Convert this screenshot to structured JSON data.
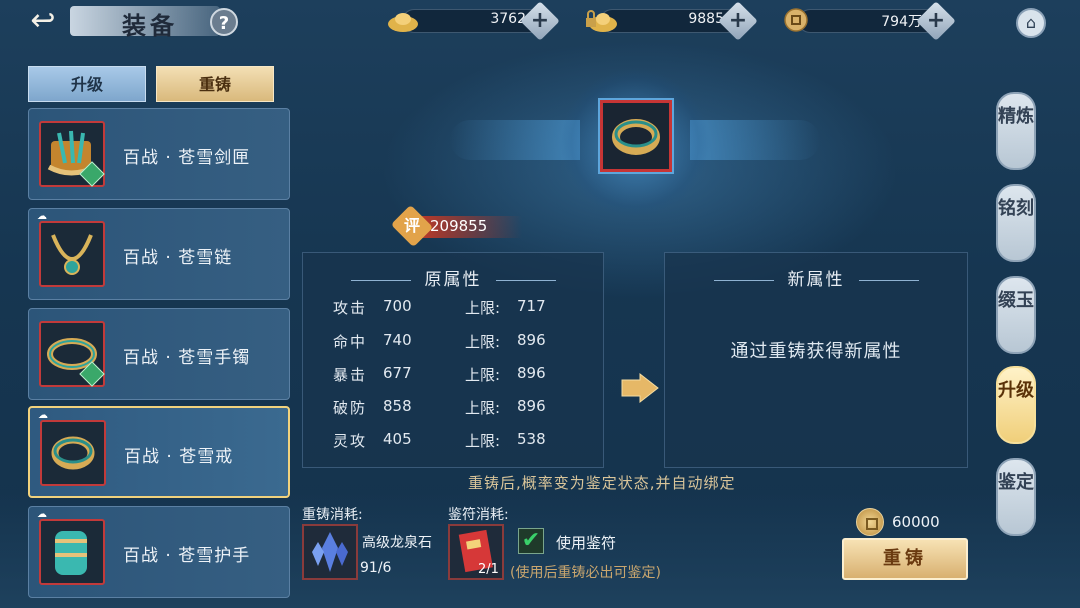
{
  "header": {
    "title": "装备",
    "back_icon": "back-arrow-icon",
    "help_label": "?"
  },
  "currencies": [
    {
      "icon": "gold-ingot-icon",
      "value": "3762",
      "plus": "+"
    },
    {
      "icon": "locked-ingot-icon",
      "value": "9885",
      "plus": "+"
    },
    {
      "icon": "copper-coin-icon",
      "value": "794万",
      "plus": "+"
    }
  ],
  "left_tabs": {
    "upgrade": "升级",
    "reforge": "重铸"
  },
  "equipment_list": [
    {
      "name": "百战 · 苍雪剑匣",
      "selected": false
    },
    {
      "name": "百战 · 苍雪链",
      "selected": false
    },
    {
      "name": "百战 · 苍雪手镯",
      "selected": false
    },
    {
      "name": "百战 · 苍雪戒",
      "selected": true
    },
    {
      "name": "百战 · 苍雪护手",
      "selected": false
    }
  ],
  "score": {
    "badge": "评",
    "value": "209855"
  },
  "old_attrs": {
    "title": "原属性",
    "limit_label": "上限:",
    "rows": [
      {
        "name": "攻击",
        "value": "700",
        "limit": "717"
      },
      {
        "name": "命中",
        "value": "740",
        "limit": "896"
      },
      {
        "name": "暴击",
        "value": "677",
        "limit": "896"
      },
      {
        "name": "破防",
        "value": "858",
        "limit": "896"
      },
      {
        "name": "灵攻",
        "value": "405",
        "limit": "538"
      }
    ]
  },
  "new_attrs": {
    "title": "新属性",
    "hint": "通过重铸获得新属性"
  },
  "notice": "重铸后,概率变为鉴定状态,并自动绑定",
  "costs": {
    "reforge_label": "重铸消耗:",
    "material_name": "高级龙泉石",
    "material_count": "91/6",
    "talisman_label": "鉴符消耗:",
    "talisman_count": "2/1",
    "use_talisman_label": "使用鉴符",
    "use_talisman_checked": true,
    "use_talisman_note": "(使用后重铸必出可鉴定)",
    "coin_cost": "60000"
  },
  "reforge_button": "重铸",
  "right_nav": [
    {
      "label": "精炼",
      "active": false
    },
    {
      "label": "铭刻",
      "active": false
    },
    {
      "label": "缀玉",
      "active": false
    },
    {
      "label": "升级",
      "active": true
    },
    {
      "label": "鉴定",
      "active": false
    }
  ]
}
